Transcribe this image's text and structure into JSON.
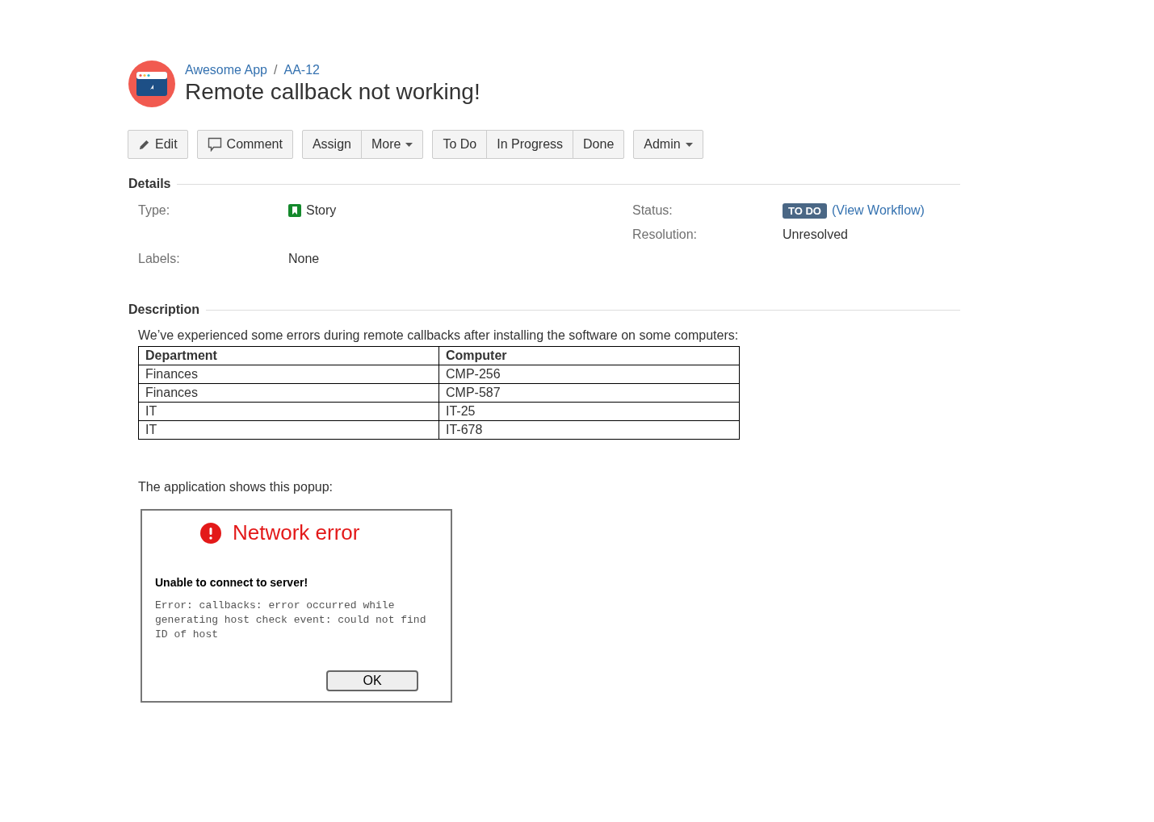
{
  "header": {
    "breadcrumbs": [
      "Awesome App",
      "AA-12"
    ],
    "separator": "/",
    "title": "Remote callback not working!"
  },
  "toolbar": [
    [
      {
        "label": "Edit",
        "kind": "edit"
      }
    ],
    [
      {
        "label": "Comment",
        "kind": "comment"
      }
    ],
    [
      {
        "label": "Assign",
        "kind": "plain"
      },
      {
        "label": "More",
        "kind": "dropdown"
      }
    ],
    [
      {
        "label": "To Do",
        "kind": "plain"
      },
      {
        "label": "In Progress",
        "kind": "plain"
      },
      {
        "label": "Done",
        "kind": "plain"
      }
    ],
    [
      {
        "label": "Admin",
        "kind": "dropdown"
      }
    ]
  ],
  "details": {
    "heading": "Details",
    "left": [
      {
        "label": "Type:",
        "kind": "type",
        "value": "Story"
      },
      {
        "label": "Labels:",
        "kind": "text",
        "value": "None"
      }
    ],
    "right": [
      {
        "label": "Status:",
        "kind": "status",
        "badge": "TO DO",
        "link": "(View Workflow)"
      },
      {
        "label": "Resolution:",
        "kind": "text",
        "value": "Unresolved"
      }
    ]
  },
  "description": {
    "heading": "Description",
    "intro": "We’ve experienced some errors during remote callbacks after installing the software on some computers:",
    "table": {
      "columns": [
        "Department",
        "Computer"
      ],
      "rows": [
        [
          "Finances",
          "CMP-256"
        ],
        [
          "Finances",
          "CMP-587"
        ],
        [
          "IT",
          "IT-25"
        ],
        [
          "IT",
          "IT-678"
        ]
      ]
    },
    "outro": "The application shows this popup:",
    "popup": {
      "title": "Network error",
      "message": "Unable to connect to server!",
      "detail": "Error: callbacks: error occurred while generating host check event: could not find ID of host",
      "button": "OK"
    }
  }
}
